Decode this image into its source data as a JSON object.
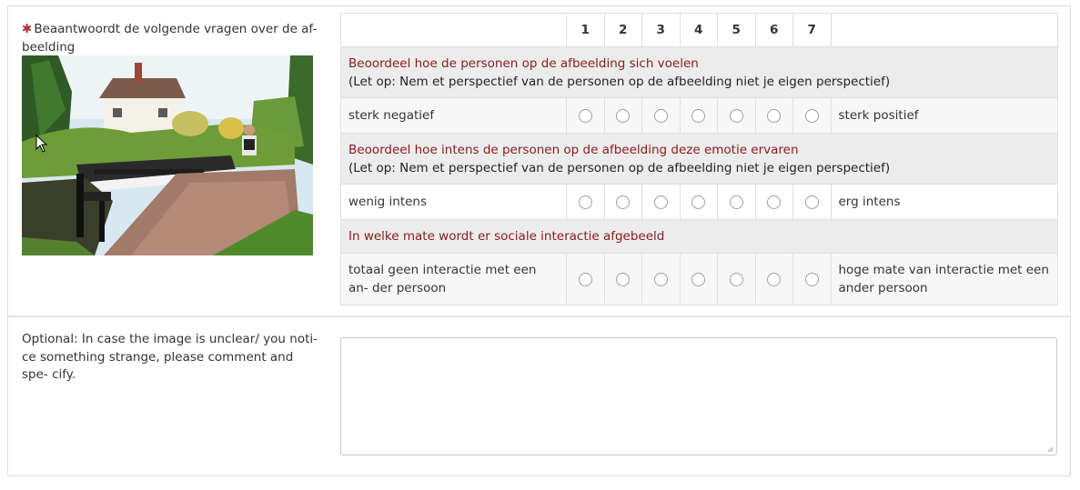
{
  "question": {
    "required_marker": "✱",
    "label": "Beaantwoordt de volgende vragen over de af- beelding"
  },
  "grid": {
    "scale": [
      "1",
      "2",
      "3",
      "4",
      "5",
      "6",
      "7"
    ],
    "items": [
      {
        "title": "Beoordeel hoe de personen op de afbeelding sich voelen",
        "note": "(Let op: Nem et perspectief van de personen op de afbeelding niet je eigen perspectief)",
        "left": "sterk negatief",
        "right": "sterk positief"
      },
      {
        "title": "Beoordeel hoe intens de personen op de afbeelding deze emotie ervaren",
        "note": "(Let op: Nem et perspectief van de personen op de afbeelding niet je eigen perspectief)",
        "left": "wenig intens",
        "right": "erg intens"
      },
      {
        "title": "In welke mate wordt er sociale interactie afgebeeld",
        "left": "totaal geen interactie met een an- der persoon",
        "right": "hoge mate van interactie met een ander persoon"
      }
    ]
  },
  "optional": {
    "label": "Optional: In case the image is unclear/ you noti- ce something strange, please comment and spe- cify.",
    "value": ""
  },
  "colors": {
    "question_title": "#8a1a1a",
    "required_marker": "#aa3333",
    "row_shade": "#ececec"
  },
  "icons": {
    "cursor": "mouse-pointer-icon",
    "resize": "resize-grip-icon"
  }
}
